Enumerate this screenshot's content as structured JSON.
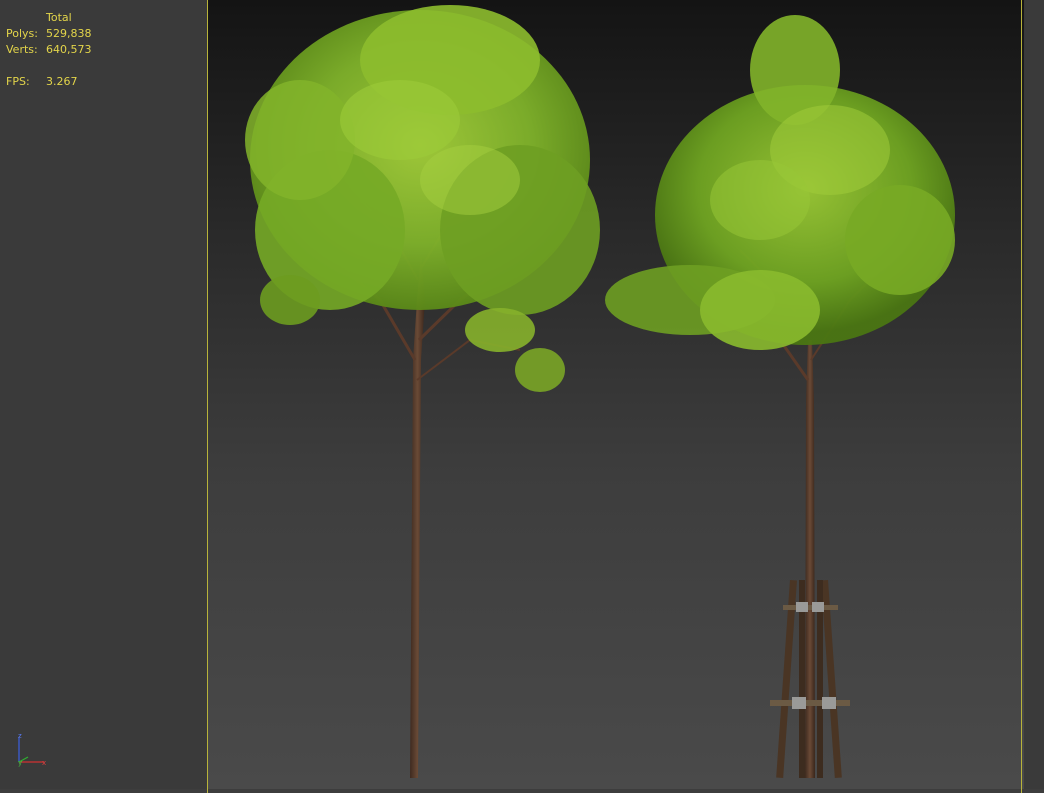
{
  "stats": {
    "header": "Total",
    "polys_label": "Polys:",
    "polys_value": "529,838",
    "verts_label": "Verts:",
    "verts_value": "640,573",
    "fps_label": "FPS:",
    "fps_value": "3.267"
  },
  "axis_gizmo": {
    "z_label": "z",
    "y_label": "y",
    "x_label": "x"
  },
  "colors": {
    "stats_text": "#e3d54a",
    "safe_frame": "#b8b33a",
    "foliage_light": "#8bbf2a",
    "foliage_dark": "#4f7a12",
    "trunk": "#5a3a2a"
  }
}
